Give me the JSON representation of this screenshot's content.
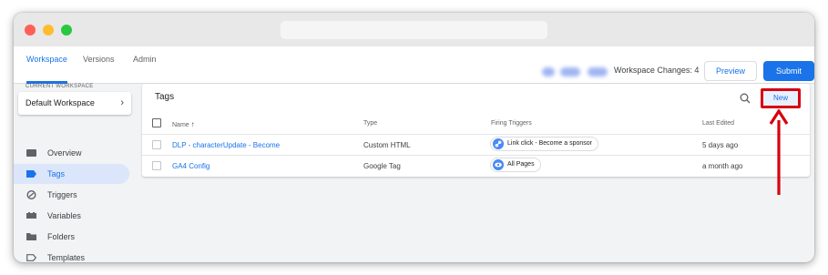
{
  "window": {
    "traffic_lights": [
      "close",
      "minimize",
      "maximize"
    ]
  },
  "topnav": {
    "tabs": [
      {
        "label": "Workspace",
        "active": true
      },
      {
        "label": "Versions",
        "active": false
      },
      {
        "label": "Admin",
        "active": false
      }
    ],
    "workspace_changes": "Workspace Changes: 4",
    "preview_label": "Preview",
    "submit_label": "Submit"
  },
  "sidebar": {
    "current_workspace_label": "CURRENT WORKSPACE",
    "workspace_name": "Default Workspace",
    "items": [
      {
        "label": "Overview",
        "icon": "overview-icon",
        "active": false
      },
      {
        "label": "Tags",
        "icon": "tag-icon",
        "active": true
      },
      {
        "label": "Triggers",
        "icon": "trigger-icon",
        "active": false
      },
      {
        "label": "Variables",
        "icon": "variables-icon",
        "active": false
      },
      {
        "label": "Folders",
        "icon": "folder-icon",
        "active": false
      },
      {
        "label": "Templates",
        "icon": "template-icon",
        "active": false
      }
    ]
  },
  "tags_card": {
    "title": "Tags",
    "new_label": "New",
    "columns": {
      "name": "Name",
      "sort_indicator": "↑",
      "type": "Type",
      "firing_triggers": "Firing Triggers",
      "last_edited": "Last Edited"
    },
    "rows": [
      {
        "name": "DLP - characterUpdate - Become",
        "type": "Custom HTML",
        "trigger": "Link click - Become a sponsor",
        "trigger_icon": "link-icon",
        "last_edited": "5 days ago"
      },
      {
        "name": "GA4 Config",
        "type": "Google Tag",
        "trigger": "All Pages",
        "trigger_icon": "eye-icon",
        "last_edited": "a month ago"
      }
    ]
  },
  "colors": {
    "accent": "#1a73e8",
    "highlight": "#d7000f",
    "active_nav_bg": "#dbe6fb"
  }
}
